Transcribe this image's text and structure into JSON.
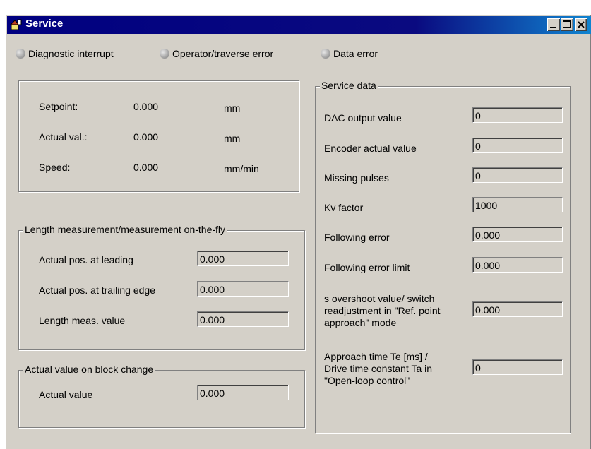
{
  "window": {
    "title": "Service",
    "icons": {
      "title": "service-icon",
      "minimize": "minimize-icon",
      "maximize": "maximize-icon",
      "close": "close-icon"
    }
  },
  "status": {
    "diagnostic": "Diagnostic interrupt",
    "operator": "Operator/traverse error",
    "data": "Data error"
  },
  "position": {
    "setpoint": {
      "label": "Setpoint:",
      "value": "0.000",
      "unit": "mm"
    },
    "actual": {
      "label": "Actual val.:",
      "value": "0.000",
      "unit": "mm"
    },
    "speed": {
      "label": "Speed:",
      "value": "0.000",
      "unit": "mm/min"
    }
  },
  "length_meas": {
    "title": "Length measurement/measurement on-the-fly",
    "leading_label": "Actual pos. at leading",
    "leading_value": "0.000",
    "trailing_label": "Actual pos. at trailing edge",
    "trailing_value": "0.000",
    "length_label": "Length meas. value",
    "length_value": "0.000"
  },
  "block_change": {
    "title": "Actual value on block change",
    "label": "Actual value",
    "value": "0.000"
  },
  "service_data": {
    "title": "Service data",
    "dac_label": "DAC output value",
    "dac_value": "0",
    "encoder_label": "Encoder actual value",
    "encoder_value": "0",
    "missing_label": "Missing pulses",
    "missing_value": "0",
    "kv_label": "Kv factor",
    "kv_value": "1000",
    "ferr_label": "Following error",
    "ferr_value": "0.000",
    "ferrlim_label": "Following error limit",
    "ferrlim_value": "0.000",
    "overshoot_l1": "s overshoot value/ switch",
    "overshoot_l2": "readjustment in \"Ref. point",
    "overshoot_l3": "approach\" mode",
    "overshoot_value": "0.000",
    "approach_l1": "Approach time Te [ms] /",
    "approach_l2": "Drive time constant Ta in",
    "approach_l3": "\"Open-loop control\"",
    "approach_value": "0"
  }
}
